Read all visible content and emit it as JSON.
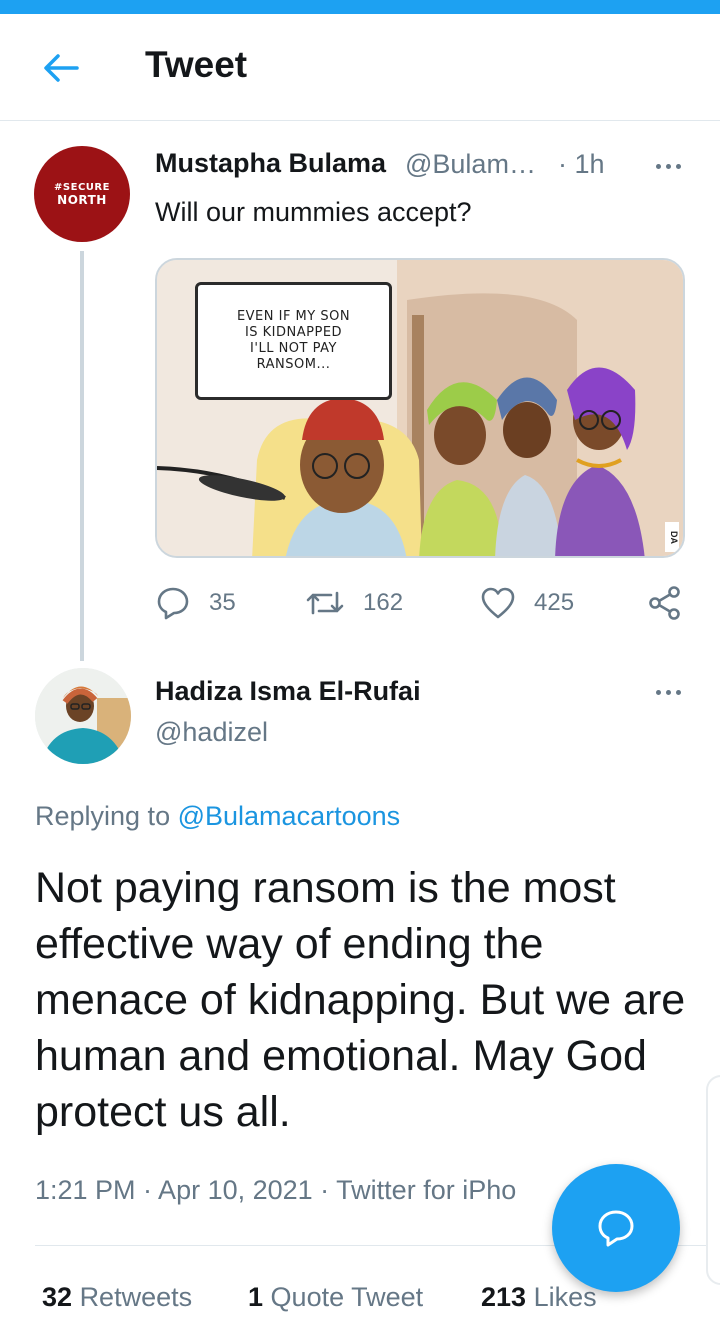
{
  "header": {
    "title": "Tweet"
  },
  "parent_tweet": {
    "author_name": "Mustapha Bulama",
    "handle": "@Bulam…",
    "time": "· 1h",
    "text": "Will our mummies accept?",
    "avatar": {
      "line1": "#SECURE",
      "line2": "NORTH"
    },
    "cartoon": {
      "speech_bubble": [
        "EVEN IF MY SON",
        "IS KIDNAPPED",
        "I'LL NOT PAY",
        "RANSOM..."
      ],
      "signature": "DA"
    },
    "actions": {
      "replies": "35",
      "retweets": "162",
      "likes": "425"
    }
  },
  "main_tweet": {
    "author_name": "Hadiza Isma El-Rufai",
    "handle": "@hadizel",
    "replying_prefix": "Replying to",
    "replying_to": "@Bulamacartoons",
    "text": "Not paying ransom is the most effective way of ending the menace of kidnapping. But we are human and emotional. May God protect us all.",
    "meta": "1:21 PM · Apr 10, 2021 · Twitter for iPho",
    "stats": {
      "retweets_count": "32",
      "retweets_label": "Retweets",
      "quote_count": "1",
      "quote_label": "Quote Tweet",
      "likes_count": "213",
      "likes_label": "Likes"
    }
  },
  "colors": {
    "accent": "#1da1f2",
    "link": "#1b95e0",
    "secondary_text": "#657786",
    "primary_text": "#14171a"
  },
  "icons": {
    "back": "arrow-left-icon",
    "reply": "reply-bubble-icon",
    "retweet": "retweet-icon",
    "like": "heart-icon",
    "share": "share-icon",
    "compose": "compose-bubble-icon",
    "more": "more-dots-icon"
  }
}
